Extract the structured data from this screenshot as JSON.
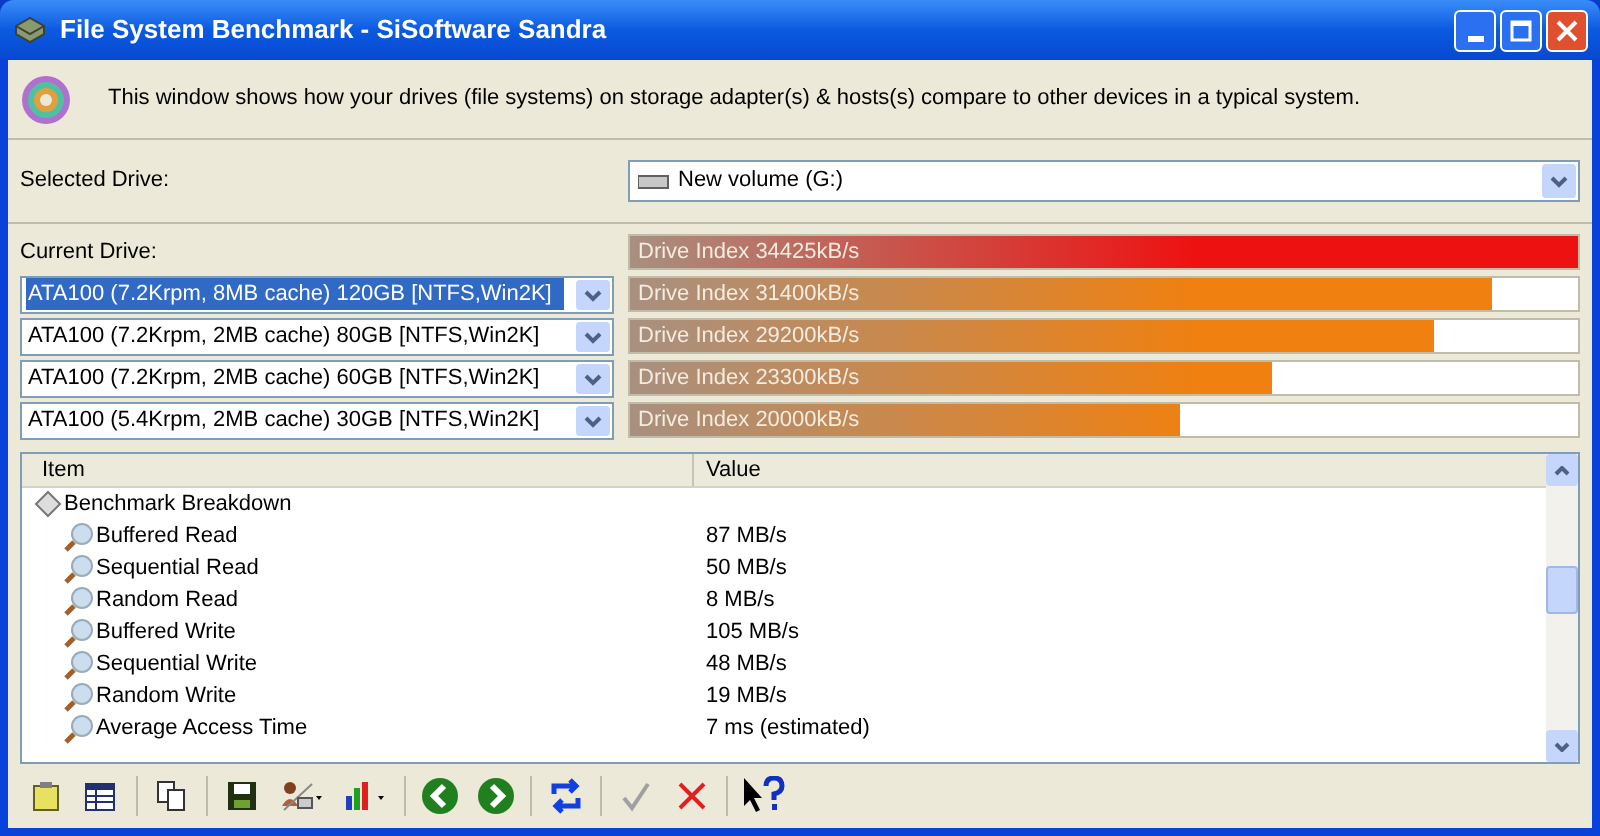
{
  "window": {
    "title": "File System Benchmark - SiSoftware Sandra"
  },
  "description": "This window shows how your drives (file systems) on storage adapter(s) & hosts(s) compare to other devices in a typical system.",
  "selected_drive": {
    "label": "Selected Drive:",
    "value": "New volume (G:)"
  },
  "current_drive_label": "Current Drive:",
  "drives": [
    {
      "index": "Drive Index 34425kB/s",
      "level": 1.0,
      "color": "#ee1111"
    },
    {
      "name": "ATA100 (7.2Krpm, 8MB cache) 120GB [NTFS,Win2K]",
      "selected": true,
      "index": "Drive Index 31400kB/s",
      "level": 0.91,
      "color": "#f08010"
    },
    {
      "name": "ATA100 (7.2Krpm, 2MB cache) 80GB [NTFS,Win2K]",
      "selected": false,
      "index": "Drive Index 29200kB/s",
      "level": 0.848,
      "color": "#f08010"
    },
    {
      "name": "ATA100 (7.2Krpm, 2MB cache) 60GB [NTFS,Win2K]",
      "selected": false,
      "index": "Drive Index 23300kB/s",
      "level": 0.677,
      "color": "#f08010"
    },
    {
      "name": "ATA100 (5.4Krpm, 2MB cache) 30GB [NTFS,Win2K]",
      "selected": false,
      "index": "Drive Index 20000kB/s",
      "level": 0.581,
      "color": "#f08010"
    }
  ],
  "table": {
    "columns": [
      "Item",
      "Value"
    ],
    "group": "Benchmark Breakdown",
    "rows": [
      {
        "item": "Buffered Read",
        "value": "87 MB/s"
      },
      {
        "item": "Sequential Read",
        "value": "50 MB/s"
      },
      {
        "item": "Random Read",
        "value": "8 MB/s"
      },
      {
        "item": "Buffered Write",
        "value": "105 MB/s"
      },
      {
        "item": "Sequential Write",
        "value": "48 MB/s"
      },
      {
        "item": "Random Write",
        "value": "19 MB/s"
      },
      {
        "item": "Average Access Time",
        "value": "7 ms (estimated)"
      }
    ]
  }
}
